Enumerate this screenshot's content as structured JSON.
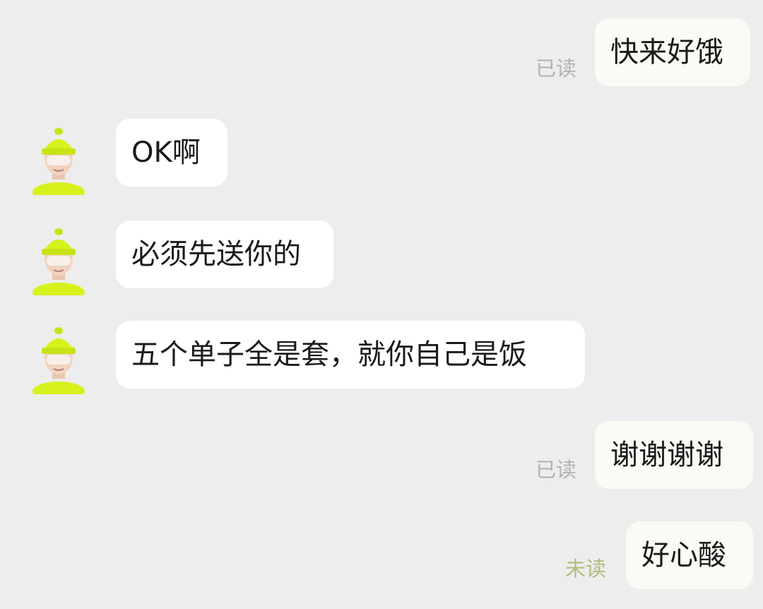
{
  "colors": {
    "background": "#ededed",
    "bubble": "#ffffff",
    "read_status": "#b3b3b3",
    "unread_status": "#b5ba7c",
    "avatar_accent": "#d7f11d"
  },
  "messages": [
    {
      "side": "right",
      "text": "快来好饿",
      "status": "已读"
    },
    {
      "side": "left",
      "text": "OK啊",
      "avatar": "courier-avatar-icon"
    },
    {
      "side": "left",
      "text": "必须先送你的",
      "avatar": "courier-avatar-icon"
    },
    {
      "side": "left",
      "text": "五个单子全是套，就你自己是饭",
      "avatar": "courier-avatar-icon"
    },
    {
      "side": "right",
      "text": "谢谢谢谢",
      "status": "已读"
    },
    {
      "side": "right",
      "text": "好心酸",
      "status": "未读"
    }
  ]
}
